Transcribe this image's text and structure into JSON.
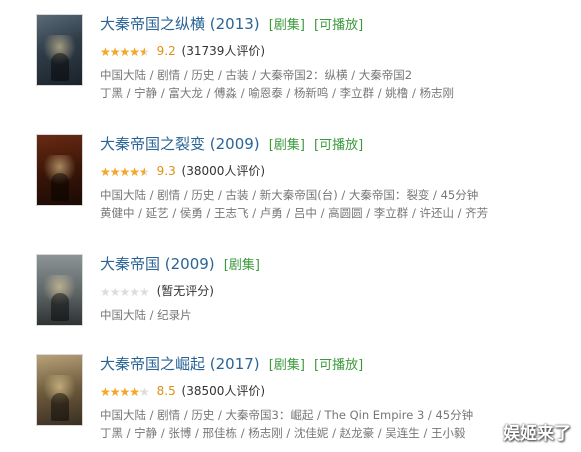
{
  "items": [
    {
      "title": "大秦帝国之纵横 (2013)",
      "tags": [
        "[剧集]",
        "[可播放]"
      ],
      "rating_fraction": 0.92,
      "score": "9.2",
      "votes": "(31739人评价)",
      "meta": "中国大陆 / 剧情 / 历史 / 古装 / 大秦帝国2：纵横 / 大秦帝国2",
      "cast": "丁黑 / 宁静 / 富大龙 / 傅淼 / 喻恩泰 / 杨新鸣 / 李立群 / 姚橹 / 杨志刚"
    },
    {
      "title": "大秦帝国之裂变 (2009)",
      "tags": [
        "[剧集]",
        "[可播放]"
      ],
      "rating_fraction": 0.93,
      "score": "9.3",
      "votes": "(38000人评价)",
      "meta": "中国大陆 / 剧情 / 历史 / 古装 / 新大秦帝国(台) / 大秦帝国：裂变 / 45分钟",
      "cast": "黄健中 / 延艺 / 侯勇 / 王志飞 / 卢勇 / 吕中 / 高圆圆 / 李立群 / 许还山 / 齐芳"
    },
    {
      "title": "大秦帝国 (2009)",
      "tags": [
        "[剧集]"
      ],
      "rating_fraction": 0,
      "no_score": "(暂无评分)",
      "meta": "中国大陆 / 纪录片"
    },
    {
      "title": "大秦帝国之崛起 (2017)",
      "tags": [
        "[剧集]",
        "[可播放]"
      ],
      "rating_fraction": 0.85,
      "score": "8.5",
      "votes": "(38500人评价)",
      "meta": "中国大陆 / 剧情 / 历史 / 大秦帝国3：崛起 / The Qin Empire 3 / 45分钟",
      "cast": "丁黑 / 宁静 / 张博 / 邢佳栋 / 杨志刚 / 沈佳妮 / 赵龙豪 / 吴连生 / 王小毅"
    }
  ],
  "stars_glyphs": "★★★★★",
  "watermark": "娱姬来了",
  "colors": {
    "title_link": "#2a6496",
    "tag_green": "#3c9a3c",
    "star_fill": "#f5a623",
    "score": "#e09015",
    "meta_gray": "#777777"
  },
  "icons": {
    "star": "star-icon"
  }
}
